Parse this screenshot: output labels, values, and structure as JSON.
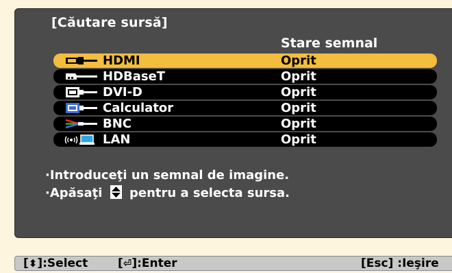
{
  "title": "[Căutare sursă]",
  "column_header": "Stare semnal",
  "sources": [
    {
      "label": "HDMI",
      "status": "Oprit",
      "icon": "hdmi-icon",
      "selected": true
    },
    {
      "label": "HDBaseT",
      "status": "Oprit",
      "icon": "hdbaset-icon",
      "selected": false
    },
    {
      "label": "DVI-D",
      "status": "Oprit",
      "icon": "dvi-icon",
      "selected": false
    },
    {
      "label": "Calculator",
      "status": "Oprit",
      "icon": "computer-vga-icon",
      "selected": false
    },
    {
      "label": "BNC",
      "status": "Oprit",
      "icon": "bnc-icon",
      "selected": false
    },
    {
      "label": "LAN",
      "status": "Oprit",
      "icon": "lan-icon",
      "selected": false
    }
  ],
  "hints": {
    "line1": "·Introduceţi un semnal de imagine.",
    "line2_prefix": "·Apăsaţi",
    "line2_suffix": "pentru a selecta sursa."
  },
  "statusbar": {
    "select_open": "[",
    "select_close": "]:Select",
    "enter_open": "[",
    "enter_close": "]:Enter",
    "exit": "[Esc] :Ieşire"
  },
  "colors": {
    "panel": "#4b4b4b",
    "selected_row": "#f3bd3d",
    "row": "#000000",
    "background": "#fdf5dd"
  }
}
